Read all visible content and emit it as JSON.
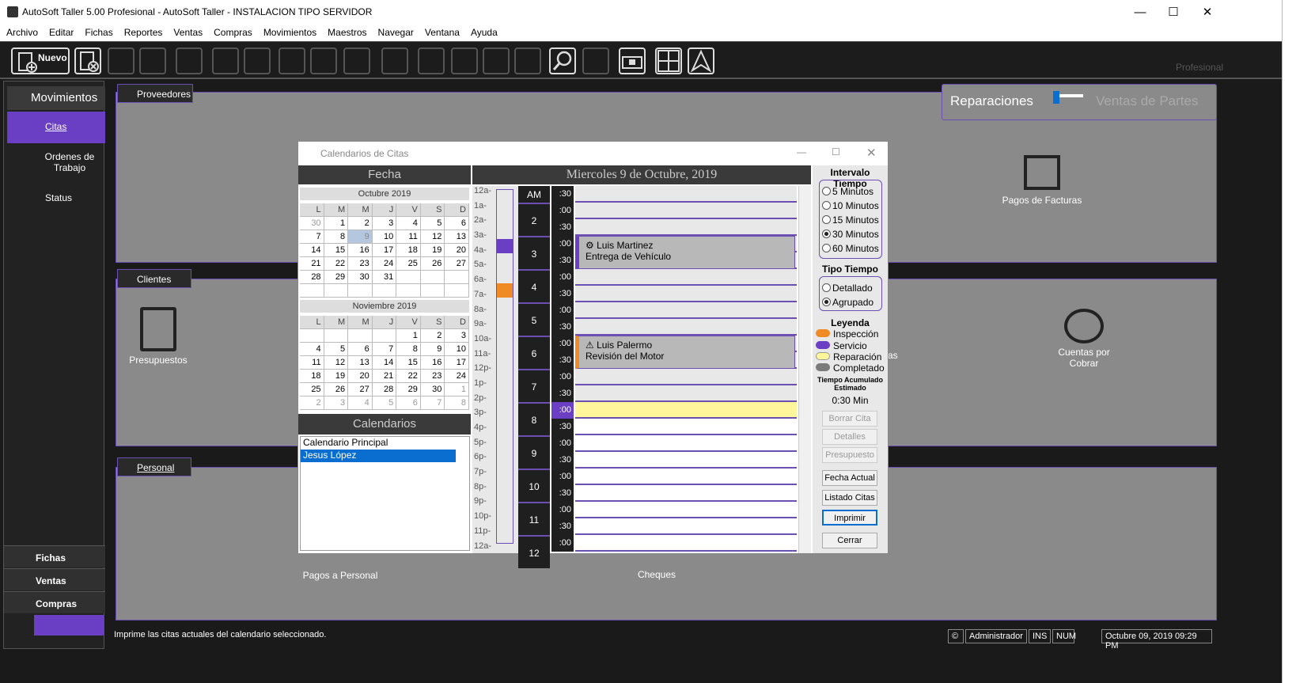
{
  "window": {
    "title": "AutoSoft Taller 5.00 Profesional - AutoSoft Taller - INSTALACION TIPO SERVIDOR"
  },
  "menu": [
    "Archivo",
    "Editar",
    "Fichas",
    "Reportes",
    "Ventas",
    "Compras",
    "Movimientos",
    "Maestros",
    "Navegar",
    "Ventana",
    "Ayuda"
  ],
  "toolbar": {
    "new_label": "Nuevo",
    "edition_label": "Profesional"
  },
  "sidebar": {
    "header": "Movimientos",
    "items": [
      {
        "label": "Citas"
      },
      {
        "label": "Ordenes de Trabajo"
      },
      {
        "label": "Status"
      }
    ],
    "bottom": [
      {
        "label": "Fichas"
      },
      {
        "label": "Ventas"
      },
      {
        "label": "Compras"
      }
    ]
  },
  "workspace": {
    "tabs": {
      "proveedores": "Proveedores",
      "clientes": "Clientes",
      "personal": "Personal"
    },
    "icons": {
      "presupuestos": "Presupuestos",
      "pagos_facturas": "Pagos de Facturas",
      "cuentas_cobrar": "Cuentas por Cobrar",
      "pagos_personal": "Pagos a Personal",
      "cheques": "Cheques",
      "partial": "as"
    },
    "switch": {
      "left": "Reparaciones",
      "right": "Ventas de Partes"
    }
  },
  "dialog": {
    "title": "Calendarios de Citas",
    "fecha_label": "Fecha",
    "day_title": "Miercoles 9 de Octubre, 2019",
    "month1": {
      "label": "Octubre 2019",
      "days": [
        "",
        "1",
        "2",
        "3",
        "4",
        "5",
        "6",
        "7",
        "8",
        "9",
        "10",
        "11",
        "12",
        "13",
        "14",
        "15",
        "16",
        "17",
        "18",
        "19",
        "20",
        "21",
        "22",
        "23",
        "24",
        "25",
        "26",
        "27",
        "28",
        "29",
        "30",
        "31"
      ]
    },
    "weekdays": [
      "L",
      "M",
      "M",
      "J",
      "V",
      "S",
      "D"
    ],
    "month2": {
      "label": "Noviembre 2019"
    },
    "calendars_label": "Calendarios",
    "calendars": [
      "Calendario Principal",
      "Jesus López"
    ],
    "hours": [
      "12a-",
      "1a-",
      "2a-",
      "3a-",
      "4a-",
      "5a-",
      "6a-",
      "7a-",
      "8a-",
      "9a-",
      "10a-",
      "11a-",
      "12p-",
      "1p-",
      "2p-",
      "3p-",
      "4p-",
      "5p-",
      "6p-",
      "7p-",
      "8p-",
      "9p-",
      "10p-",
      "11p-",
      "12a-"
    ],
    "day_rows": [
      {
        "h": "AM",
        "m": ":30"
      },
      {
        "h": "2",
        "m": ":00"
      },
      {
        "h": "",
        "m": ":30"
      },
      {
        "h": "3",
        "m": ":00"
      },
      {
        "h": "",
        "m": ":30"
      },
      {
        "h": "4",
        "m": ":00"
      },
      {
        "h": "",
        "m": ":30"
      },
      {
        "h": "5",
        "m": ":00"
      },
      {
        "h": "",
        "m": ":30"
      },
      {
        "h": "6",
        "m": ":00"
      },
      {
        "h": "",
        "m": ":30"
      },
      {
        "h": "7",
        "m": ":00"
      },
      {
        "h": "",
        "m": ":30"
      },
      {
        "h": "8",
        "m": ":00"
      },
      {
        "h": "",
        "m": ":30"
      },
      {
        "h": "9",
        "m": ":00"
      },
      {
        "h": "",
        "m": ":30"
      },
      {
        "h": "10",
        "m": ":00"
      },
      {
        "h": "",
        "m": ":30"
      },
      {
        "h": "11",
        "m": ":00"
      },
      {
        "h": "",
        "m": ":30"
      },
      {
        "h": "12",
        "m": ":00"
      }
    ],
    "appointments": [
      {
        "name": "Luis Martinez",
        "desc": "Entrega de Vehículo"
      },
      {
        "name": "Luis Palermo",
        "desc": "Revisión del Motor"
      }
    ],
    "intervalo": {
      "label": "Intervalo Tiempo",
      "options": [
        "5 Minutos",
        "10 Minutos",
        "15 Minutos",
        "30 Minutos",
        "60 Minutos"
      ],
      "selected": "30 Minutos"
    },
    "tipo": {
      "label": "Tipo Tiempo",
      "options": [
        "Detallado",
        "Agrupado"
      ],
      "selected": "Agrupado"
    },
    "leyenda": {
      "label": "Leyenda",
      "items": [
        {
          "label": "Inspección",
          "color": "#f08a24"
        },
        {
          "label": "Servicio",
          "color": "#6a3fc4"
        },
        {
          "label": "Reparación",
          "color": "#fff59a"
        },
        {
          "label": "Completado",
          "color": "#7a7a7a"
        }
      ]
    },
    "tiempo": {
      "label": "Tiempo Acumulado Estimado",
      "value": "0:30 Min"
    },
    "buttons": [
      "Borrar Cita",
      "Detalles",
      "Presupuesto",
      "Fecha Actual",
      "Listado Citas",
      "Imprimir",
      "Cerrar"
    ]
  },
  "status": {
    "message": "Imprime las citas actuales del calendario seleccionado.",
    "user": "Administrador",
    "ins": "INS",
    "num": "NUM",
    "datetime": "Octubre 09, 2019 09:29 PM"
  }
}
